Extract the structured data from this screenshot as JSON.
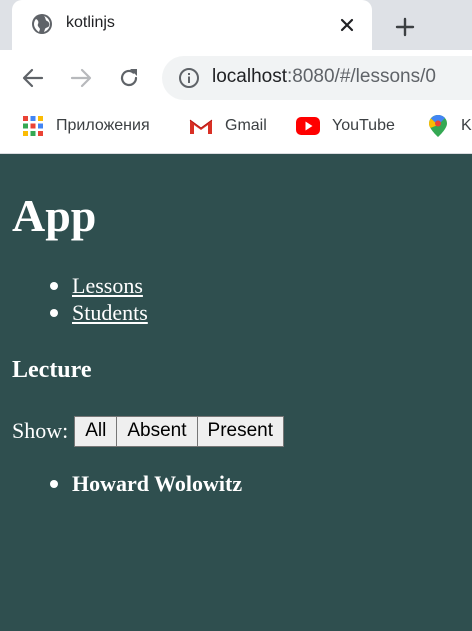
{
  "browser": {
    "tab": {
      "title": "kotlinjs"
    },
    "address_bar": {
      "host": "localhost",
      "rest": ":8080/#/lessons/0"
    },
    "bookmarks": [
      {
        "label": "Приложения",
        "icon": "apps-grid-icon"
      },
      {
        "label": "Gmail",
        "icon": "gmail-icon"
      },
      {
        "label": "YouTube",
        "icon": "youtube-icon"
      },
      {
        "label": "K",
        "icon": "maps-icon"
      }
    ]
  },
  "page": {
    "title": "App",
    "nav": [
      {
        "label": "Lessons"
      },
      {
        "label": "Students"
      }
    ],
    "section_title": "Lecture",
    "filter": {
      "label": "Show:",
      "options": [
        {
          "label": "All"
        },
        {
          "label": "Absent"
        },
        {
          "label": "Present"
        }
      ]
    },
    "students": [
      {
        "name": "Howard Wolowitz"
      }
    ]
  },
  "colors": {
    "page_background": "#2f4f4f",
    "tab_strip": "#dee1e6",
    "omnibox": "#f1f3f4"
  }
}
